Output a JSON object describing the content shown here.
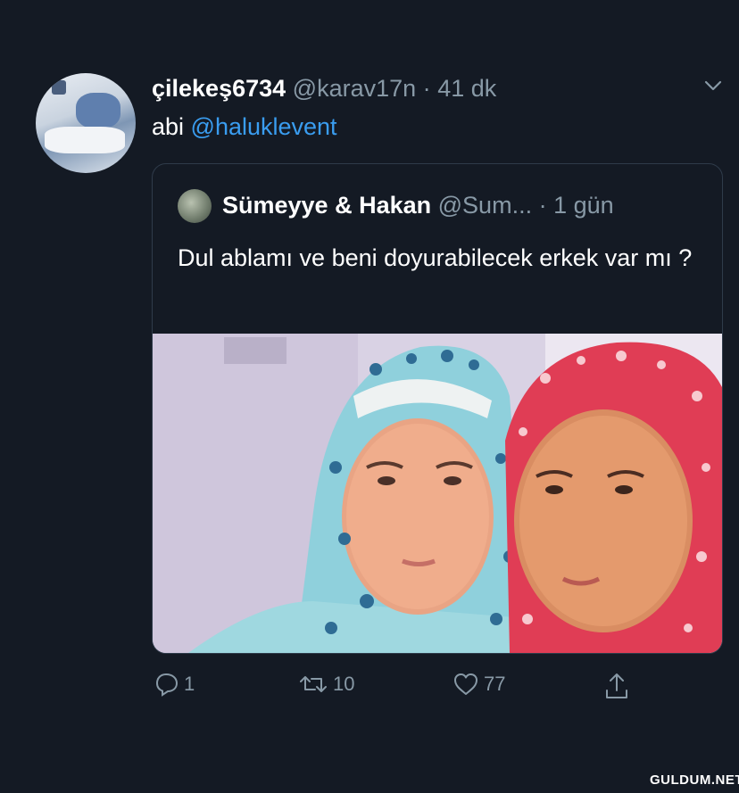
{
  "tweet": {
    "username": "çilekeş6734",
    "handle": "@karav17n",
    "separator": "·",
    "time": "41 dk",
    "text_prefix": "abi ",
    "mention": "@haluklevent"
  },
  "quoted_tweet": {
    "username": "Sümeyye & Hakan",
    "handle": "@Sum...",
    "separator": "·",
    "time": "1 gün",
    "text": "Dul ablamı ve beni doyurabilecek erkek var mı ?"
  },
  "actions": {
    "reply_count": "1",
    "retweet_count": "10",
    "like_count": "77"
  },
  "icons": {
    "chevron": "chevron-down-icon",
    "reply": "reply-icon",
    "retweet": "retweet-icon",
    "like": "heart-icon",
    "share": "share-icon"
  },
  "colors": {
    "background": "#141a24",
    "mention": "#3a9df0",
    "meta": "#8899a6"
  },
  "watermark": "GULDUM.NET"
}
